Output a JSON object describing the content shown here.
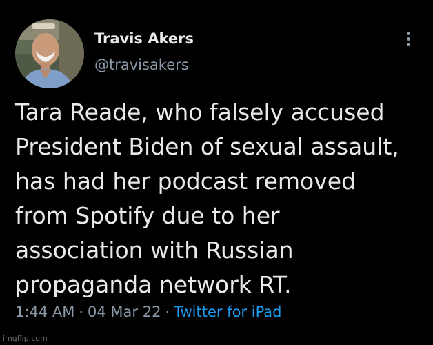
{
  "author": {
    "name": "Travis Akers",
    "handle": "@travisakers",
    "avatar_icon": "profile-photo"
  },
  "menu": {
    "icon": "more-vertical-icon"
  },
  "tweet": {
    "lines": [
      "Tara Reade, who falsely accused",
      "President Biden of sexual assault,",
      "has had her podcast removed",
      "from Spotify due to her",
      "association with Russian",
      "propaganda network RT."
    ]
  },
  "meta": {
    "time": "1:44 AM",
    "separator": "·",
    "date": "04 Mar 22",
    "source": "Twitter for iPad"
  },
  "watermark": "imgflip.com",
  "colors": {
    "background": "#000000",
    "text": "#e7e9ea",
    "muted": "#8b98a5",
    "link": "#1d9bf0"
  }
}
